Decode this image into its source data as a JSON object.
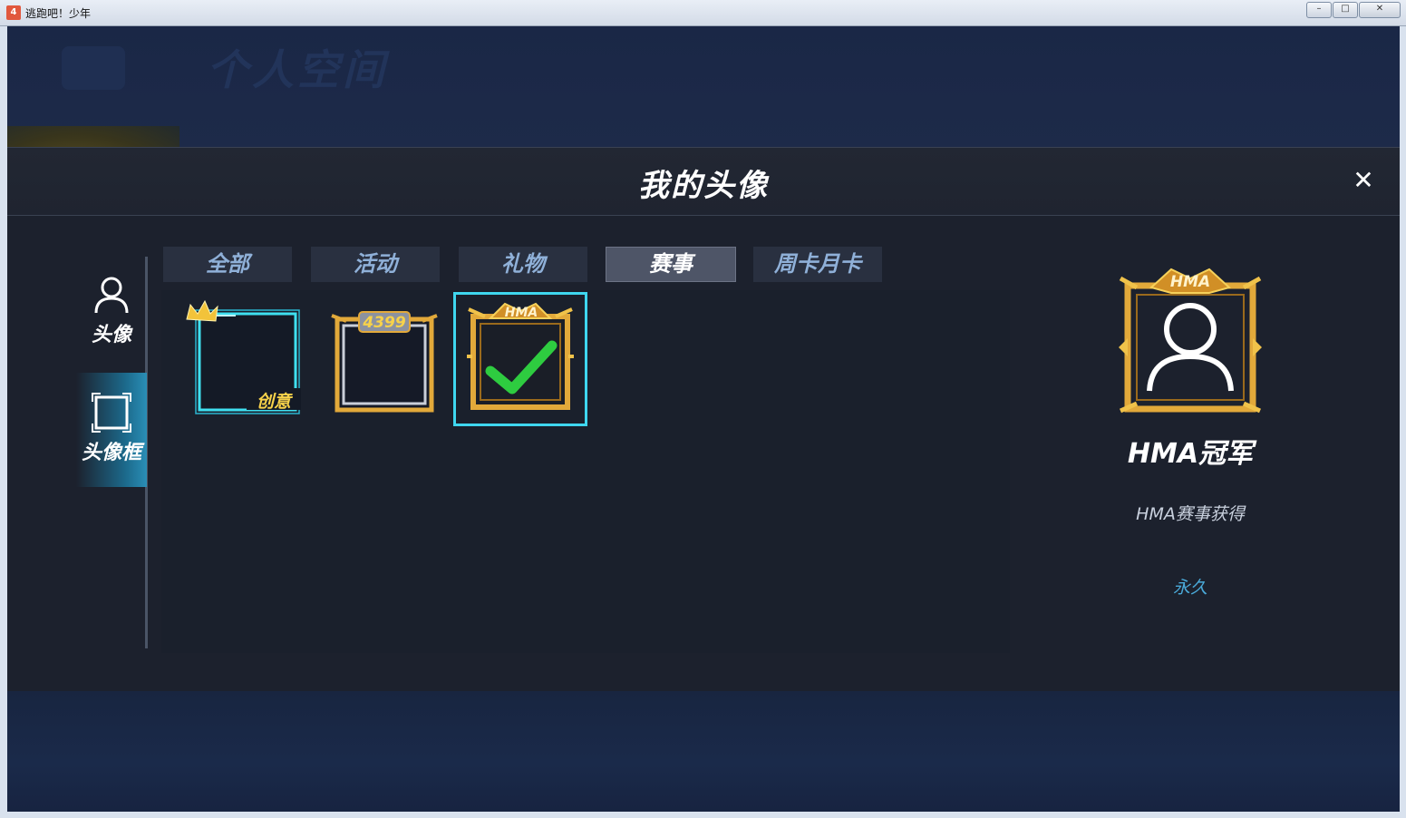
{
  "window": {
    "title": "逃跑吧！少年",
    "app_icon": "4",
    "controls": [
      "minimize-icon",
      "maximize-icon",
      "close-icon"
    ]
  },
  "background": {
    "ghost_title": "个人空间"
  },
  "dialog": {
    "title": "我的头像",
    "close_icon": "close-icon"
  },
  "sidebar": {
    "items": [
      {
        "label": "头像",
        "icon": "user-icon",
        "active": false
      },
      {
        "label": "头像框",
        "icon": "frame-icon",
        "active": true
      }
    ]
  },
  "tabs": [
    {
      "label": "全部",
      "active": false
    },
    {
      "label": "活动",
      "active": false
    },
    {
      "label": "礼物",
      "active": false
    },
    {
      "label": "赛事",
      "active": true
    },
    {
      "label": "周卡月卡",
      "active": false
    }
  ],
  "frames": [
    {
      "badge": "创意",
      "style": "cyan-crown",
      "selected": false
    },
    {
      "badge": "4399",
      "style": "gold-silver",
      "selected": false
    },
    {
      "badge": "HMA",
      "style": "gold-hma",
      "selected": true,
      "check_icon": "checkmark-icon"
    }
  ],
  "preview": {
    "banner": "HMA",
    "name": "HMA冠军",
    "source": "HMA赛事获得",
    "duration": "永久"
  },
  "colors": {
    "accent_cyan": "#3fd6ef",
    "gold": "#e2a93a",
    "duration_blue": "#4aa9d8",
    "check_green": "#2ecc40"
  }
}
